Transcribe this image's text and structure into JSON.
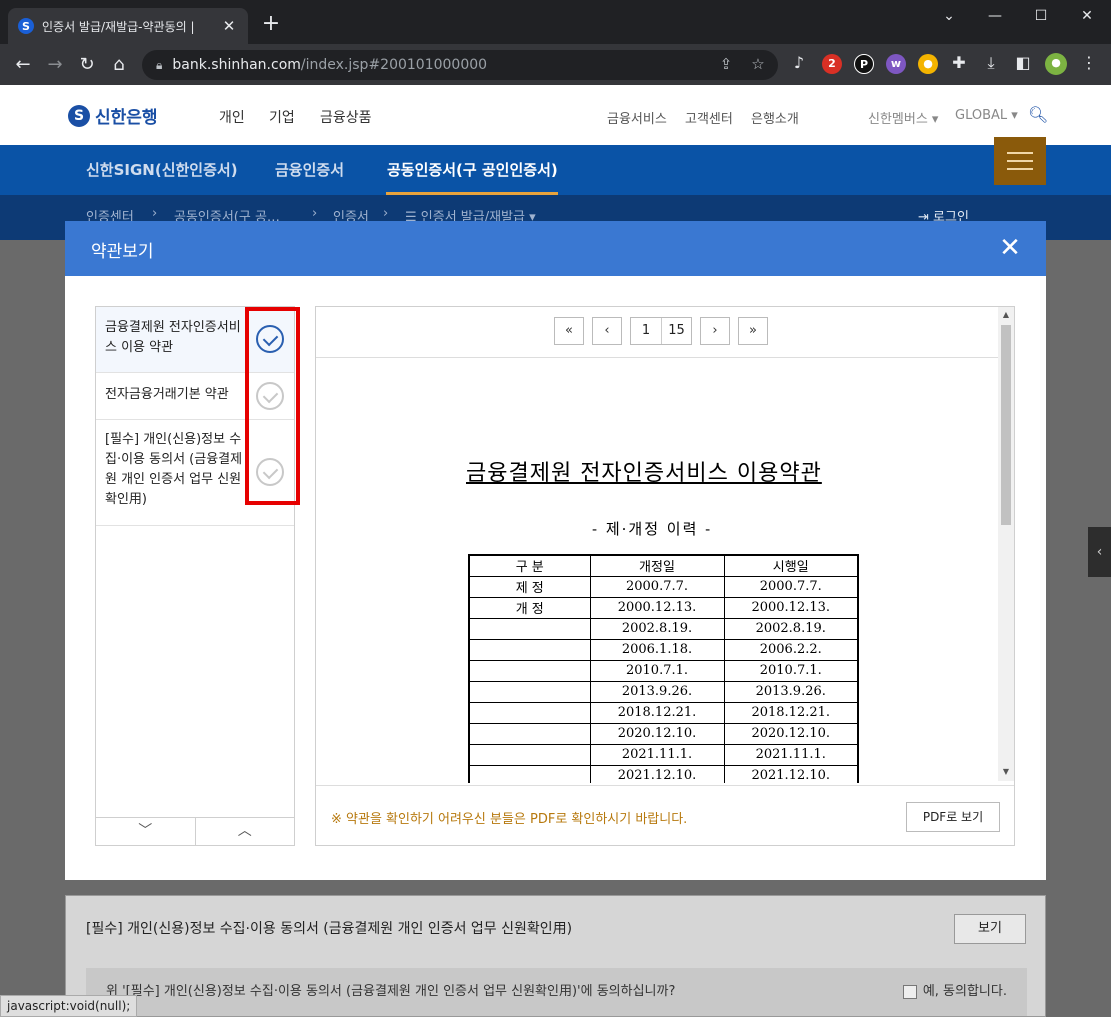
{
  "browser": {
    "tab_title": "인증서 발급/재발급-약관동의 |",
    "favicon_letter": "S",
    "url_host": "bank.shinhan.com",
    "url_path": "/index.jsp#200101000000",
    "ext_badge": "2"
  },
  "site": {
    "logo": "신한은행",
    "logo_mark": "S",
    "main_links": [
      "개인",
      "기업",
      "금융상품"
    ],
    "sub_links": [
      "금융서비스",
      "고객센터",
      "은행소개"
    ],
    "members": "신한멤버스 ▾",
    "global": "GLOBAL ▾"
  },
  "cert_nav": {
    "tabs": [
      "신한SIGN(신한인증서)",
      "금융인증서",
      "공동인증서(구 공인인증서)"
    ],
    "active_index": 2
  },
  "breadcrumb": {
    "items": [
      "인증센터",
      "›",
      "공동인증서(구 공…",
      "›",
      "인증서",
      "›",
      "☰ 인증서 발급/재발급 ▾"
    ],
    "login": "로그인"
  },
  "modal": {
    "title": "약관보기",
    "close": "✕",
    "terms": [
      {
        "label": "금융결제원 전자인증서비스 이용 약관",
        "checked": true
      },
      {
        "label": "전자금융거래기본 약관",
        "checked": false
      },
      {
        "label": "[필수] 개인(신용)정보 수집·이용 동의서 (금융결제원 개인 인증서 업무 신원확인用)",
        "checked": false
      }
    ],
    "list_down": "﹀",
    "list_up": "︿",
    "pager": {
      "first": "«",
      "prev": "‹",
      "current": "1",
      "total": "15",
      "next": "›",
      "last": "»"
    },
    "doc": {
      "title": "금융결제원 전자인증서비스 이용약관",
      "subtitle": "- 제·개정 이력 -",
      "headers": [
        "구 분",
        "개정일",
        "시행일"
      ],
      "rows": [
        [
          "제 정",
          "2000.7.7.",
          "2000.7.7."
        ],
        [
          "개 정",
          "2000.12.13.",
          "2000.12.13."
        ],
        [
          "",
          "2002.8.19.",
          "2002.8.19."
        ],
        [
          "",
          "2006.1.18.",
          "2006.2.2."
        ],
        [
          "",
          "2010.7.1.",
          "2010.7.1."
        ],
        [
          "",
          "2013.9.26.",
          "2013.9.26."
        ],
        [
          "",
          "2018.12.21.",
          "2018.12.21."
        ],
        [
          "",
          "2020.12.10.",
          "2020.12.10."
        ],
        [
          "",
          "2021.11.1.",
          "2021.11.1."
        ],
        [
          "",
          "2021.12.10.",
          "2021.12.10."
        ]
      ]
    },
    "notice": "※ 약관을 확인하기 어려우신 분들은 PDF로 확인하시기 바랍니다.",
    "pdf_button": "PDF로 보기"
  },
  "under": {
    "title": "[필수] 개인(신용)정보 수집·이용 동의서 (금융결제원 개인 인증서 업무 신원확인用)",
    "view_button": "보기",
    "question": "위 '[필수] 개인(신용)정보 수집·이용 동의서 (금융결제원 개인 인증서 업무 신원확인用)'에 동의하십니까?",
    "agree": "예, 동의합니다."
  },
  "status": "javascript:void(null);"
}
